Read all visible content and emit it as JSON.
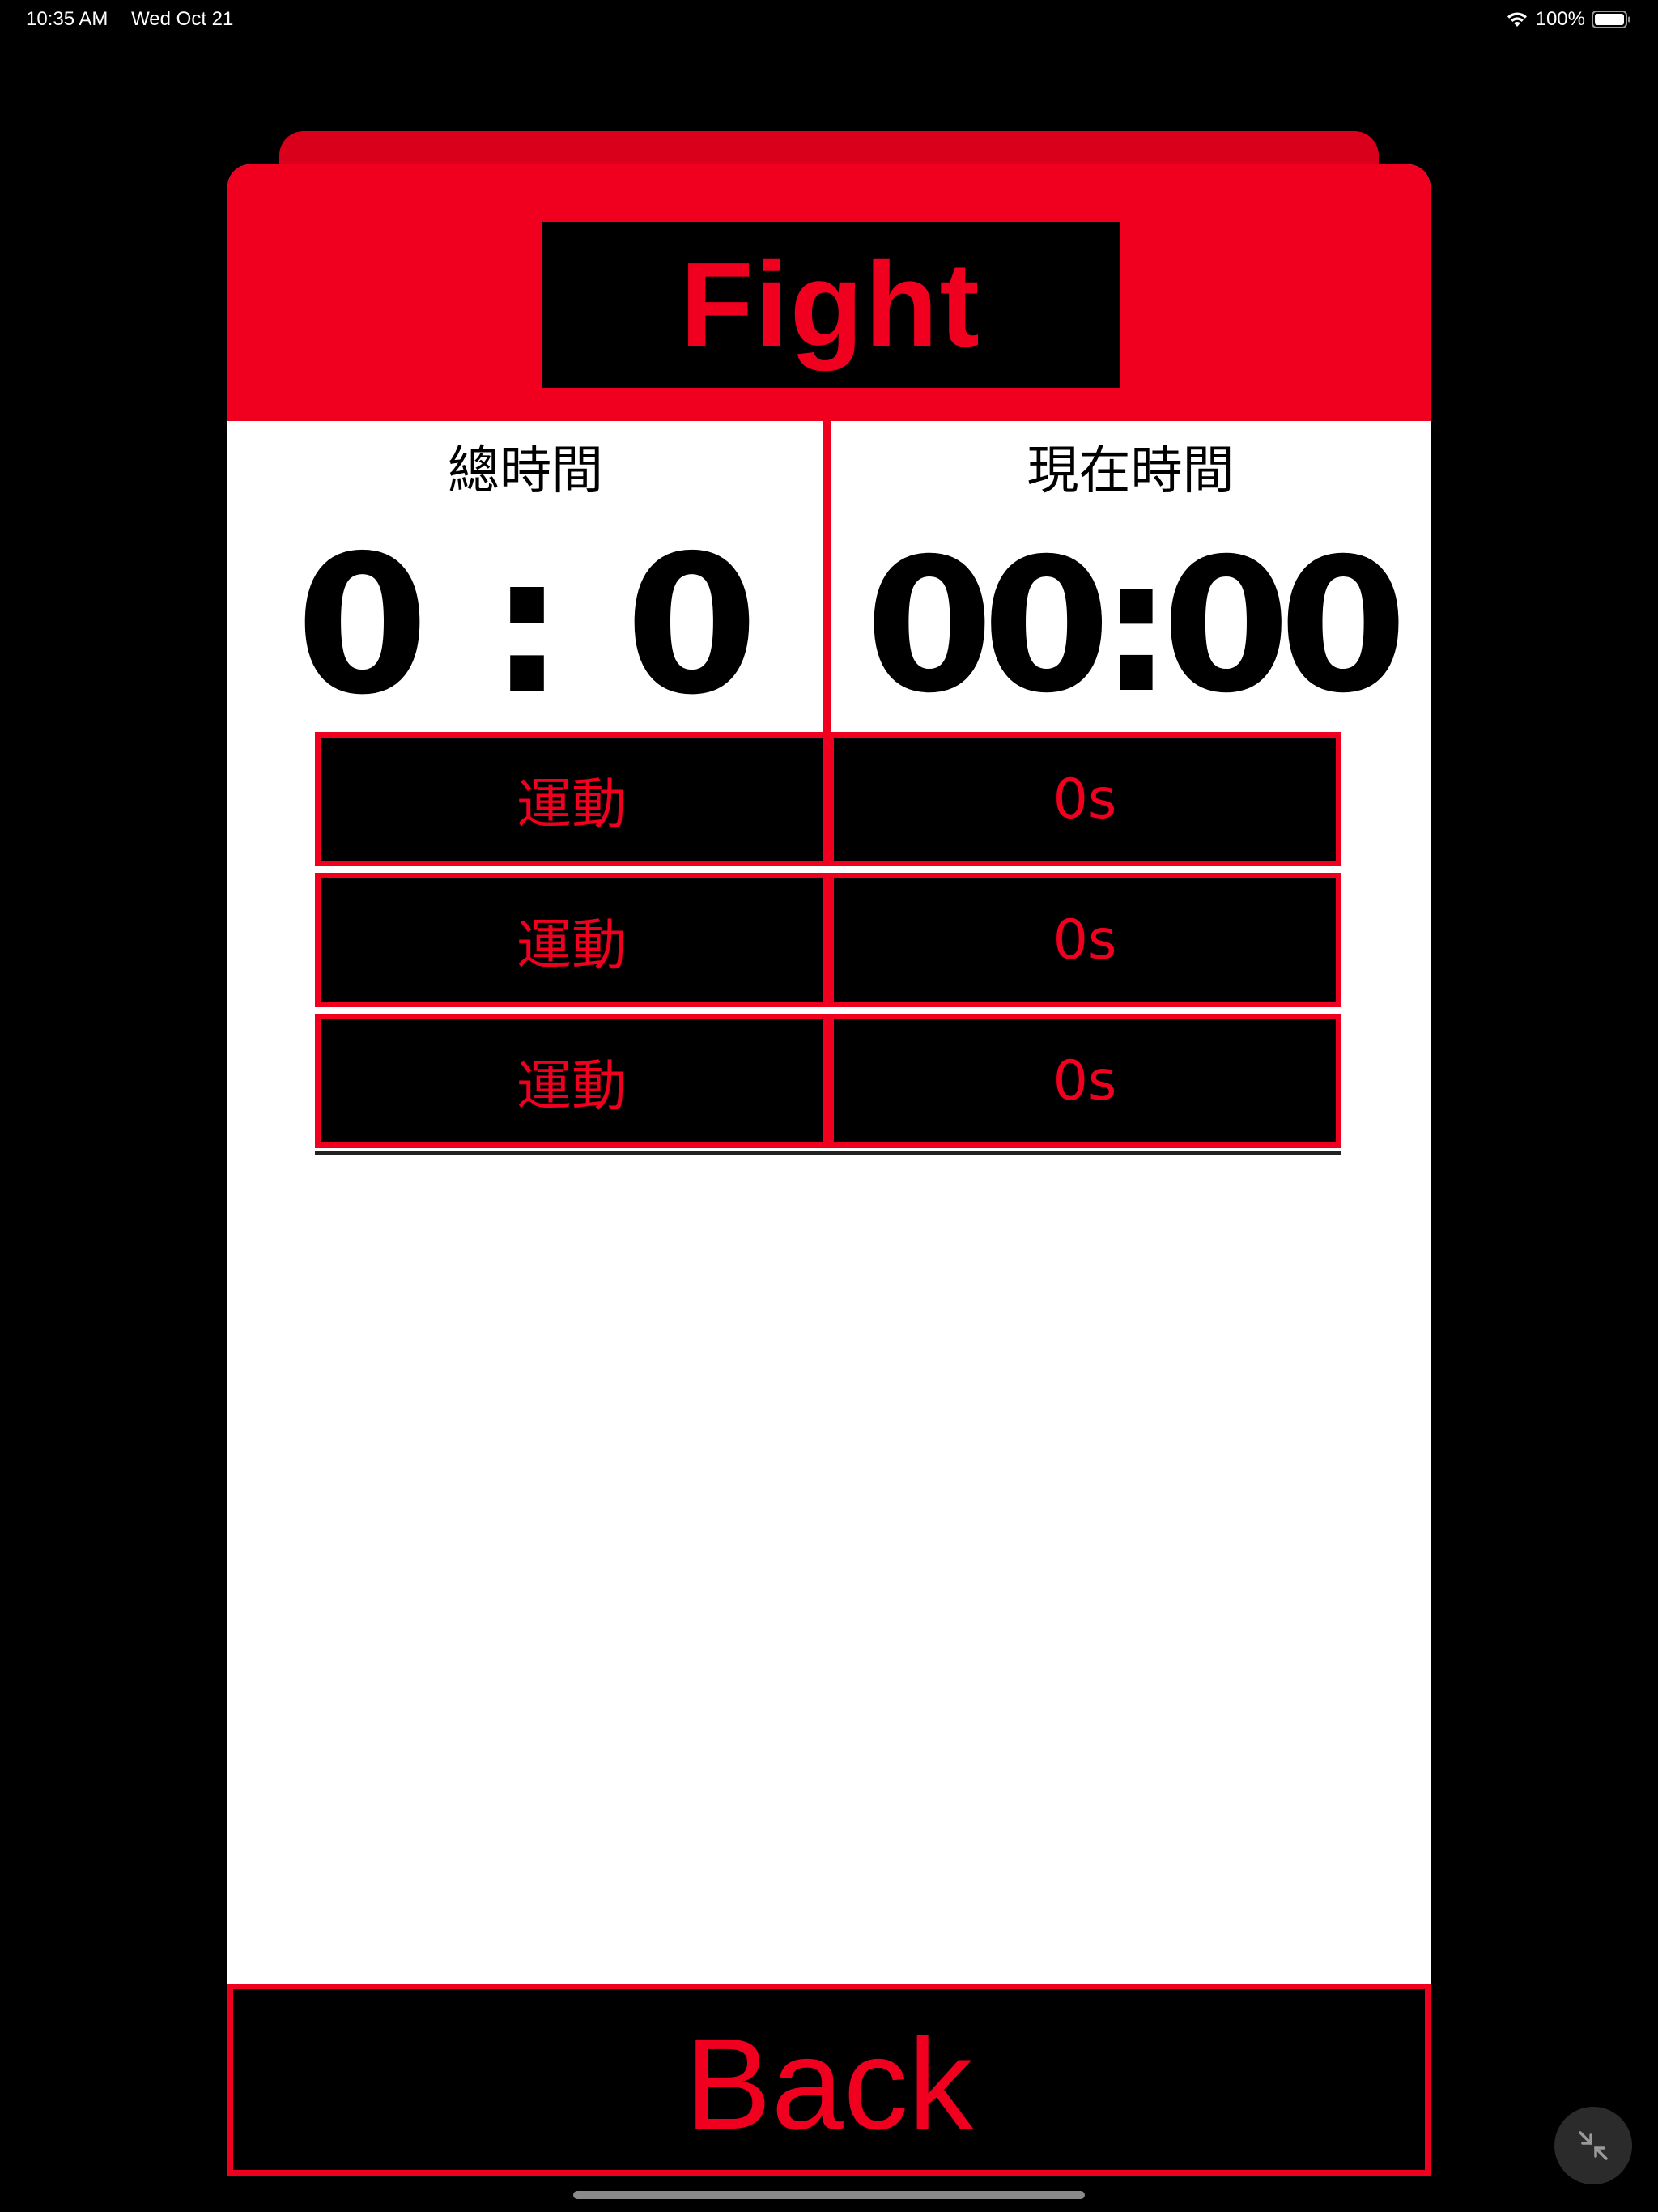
{
  "status_bar": {
    "time": "10:35 AM",
    "date": "Wed Oct 21",
    "battery_percent": "100%",
    "battery_level": 1.0
  },
  "header": {
    "title": "Fight"
  },
  "stats": {
    "total_time_label": "總時間",
    "total_time_value": "0 : 0",
    "current_time_label": "現在時間",
    "current_time_value": "00:00"
  },
  "exercise_table": {
    "rows": [
      {
        "name": "運動",
        "duration": "0s"
      },
      {
        "name": "運動",
        "duration": "0s"
      },
      {
        "name": "運動",
        "duration": "0s"
      }
    ]
  },
  "footer": {
    "back_label": "Back"
  },
  "icons": {
    "wifi": "wifi-icon",
    "battery": "battery-icon",
    "collapse": "collapse-icon"
  },
  "colors": {
    "accent": "#f0001e",
    "accent_dark": "#d8001a",
    "background": "#000000",
    "card": "#ffffff"
  }
}
